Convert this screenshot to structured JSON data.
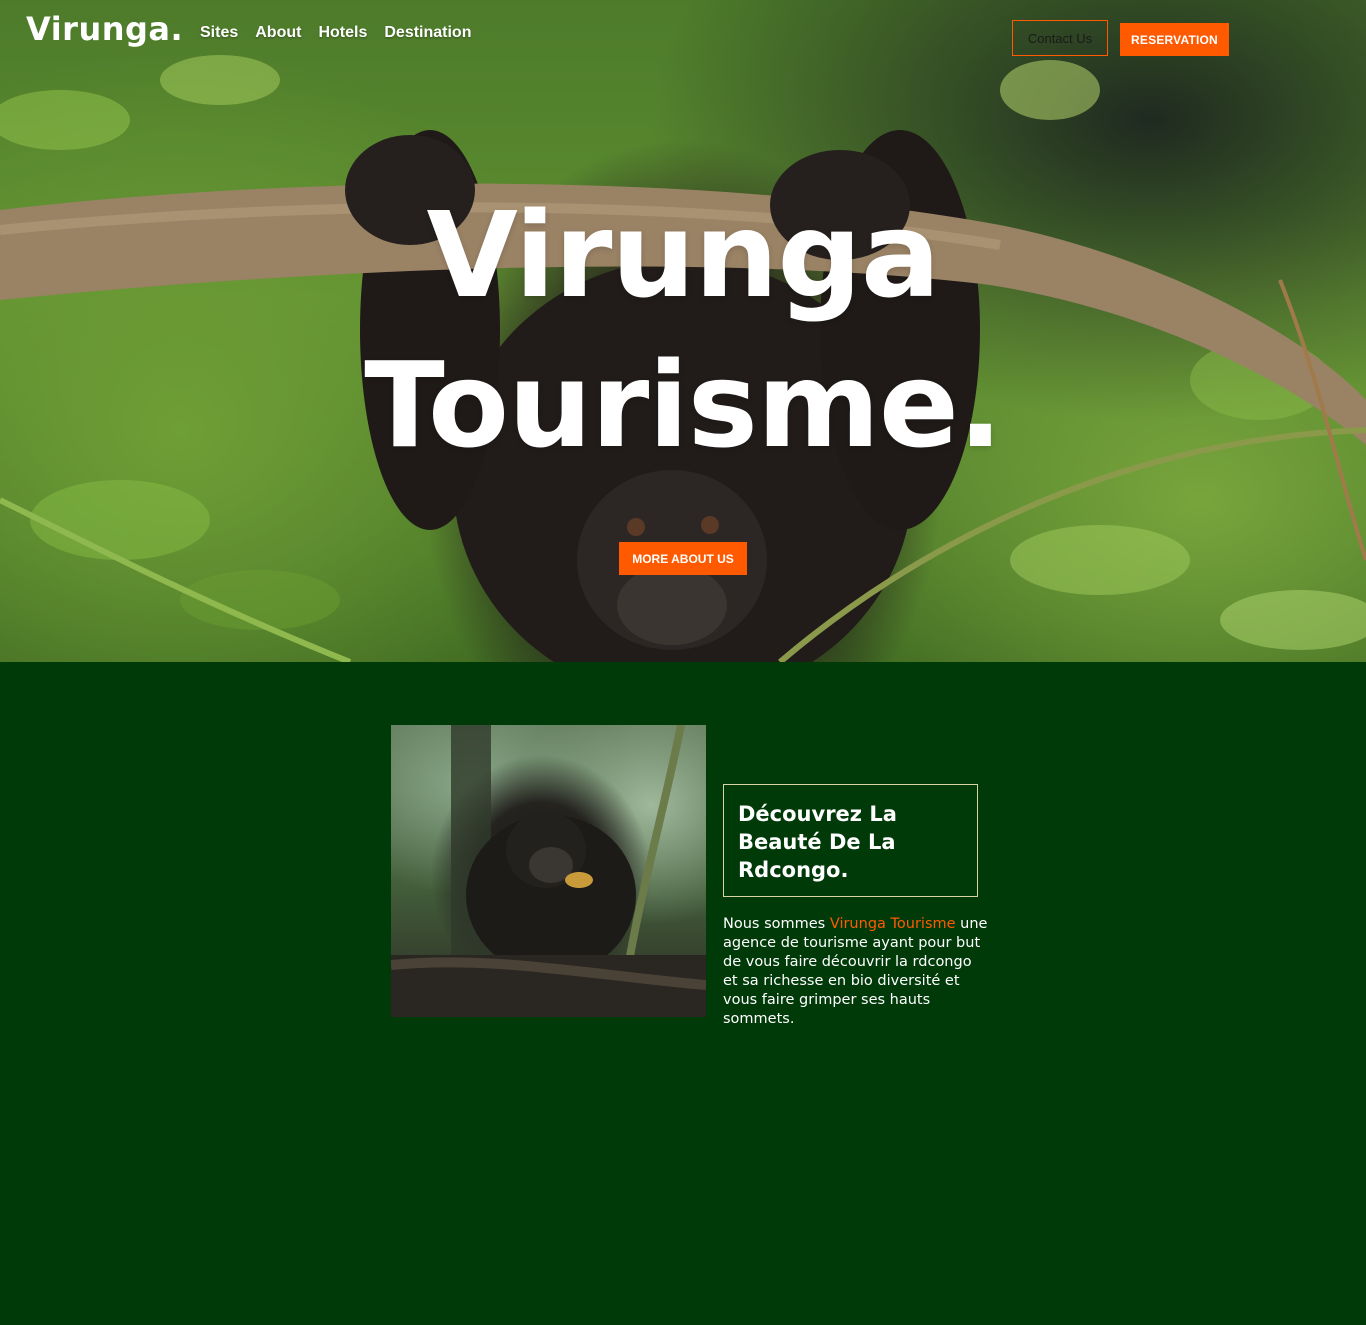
{
  "header": {
    "logo": "Virunga.",
    "nav": [
      {
        "label": "Sites"
      },
      {
        "label": "About"
      },
      {
        "label": "Hotels"
      },
      {
        "label": "Destination"
      }
    ],
    "contact_label": "Contact Us",
    "reservation_label": "RESERVATION"
  },
  "hero": {
    "title_line1": "Virunga",
    "title_line2": "Tourisme.",
    "cta_label": "MORE ABOUT US"
  },
  "about": {
    "heading": "Découvrez La Beauté De La Rdcongo.",
    "text_before": "Nous sommes ",
    "brand": "Virunga Tourisme",
    "text_after": " une agence de tourisme ayant pour but de vous faire découvrir la rdcongo et sa richesse en bio diversité et vous faire grimper ses hauts sommets."
  },
  "colors": {
    "accent": "#ff5a00",
    "section_bg": "#013a09",
    "heading_border": "#d7d3a3"
  }
}
